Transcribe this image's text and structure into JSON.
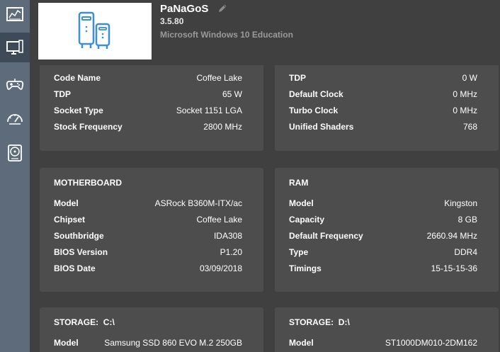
{
  "app": {
    "name": "PaNaGoS",
    "version": "3.5.80",
    "os": "Microsoft Windows 10 Education"
  },
  "sidebar": {
    "items": [
      {
        "icon": "dashboard-icon"
      },
      {
        "icon": "computer-icon",
        "active": true
      },
      {
        "icon": "gamepad-icon"
      },
      {
        "icon": "speedometer-icon"
      },
      {
        "icon": "disk-icon"
      }
    ]
  },
  "cpu": {
    "rows": [
      {
        "k": "Code Name",
        "v": "Coffee Lake"
      },
      {
        "k": "TDP",
        "v": "65 W"
      },
      {
        "k": "Socket Type",
        "v": "Socket 1151 LGA"
      },
      {
        "k": "Stock Frequency",
        "v": "2800 MHz"
      }
    ]
  },
  "gpu": {
    "rows": [
      {
        "k": "TDP",
        "v": "0 W"
      },
      {
        "k": "Default Clock",
        "v": "0 MHz"
      },
      {
        "k": "Turbo Clock",
        "v": "0 MHz"
      },
      {
        "k": "Unified Shaders",
        "v": "768"
      }
    ]
  },
  "motherboard": {
    "title": "MOTHERBOARD",
    "rows": [
      {
        "k": "Model",
        "v": "ASRock B360M-ITX/ac"
      },
      {
        "k": "Chipset",
        "v": "Coffee Lake"
      },
      {
        "k": "Southbridge",
        "v": "IDA308"
      },
      {
        "k": "BIOS Version",
        "v": "P1.20"
      },
      {
        "k": "BIOS Date",
        "v": "03/09/2018"
      }
    ]
  },
  "ram": {
    "title": "RAM",
    "rows": [
      {
        "k": "Model",
        "v": "Kingston"
      },
      {
        "k": "Capacity",
        "v": "8 GB"
      },
      {
        "k": "Default Frequency",
        "v": "2660.94 MHz"
      },
      {
        "k": "Type",
        "v": "DDR4"
      },
      {
        "k": "Timings",
        "v": "15-15-15-36"
      }
    ]
  },
  "storage_c": {
    "title": "STORAGE:  C:\\",
    "rows": [
      {
        "k": "Model",
        "v": "Samsung SSD 860 EVO M.2 250GB"
      }
    ]
  },
  "storage_d": {
    "title": "STORAGE:  D:\\",
    "rows": [
      {
        "k": "Model",
        "v": "ST1000DM010-2DM162"
      }
    ]
  }
}
